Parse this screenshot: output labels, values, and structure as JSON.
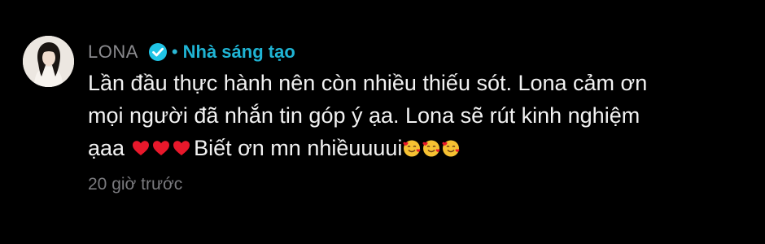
{
  "comment": {
    "username": "LONA",
    "verified_icon": "verified-check-icon",
    "badge_label": "Nhà sáng tạo",
    "text_lines": [
      "Lần đầu thực hành nên còn nhiều thiếu sót. Lona cảm ơn",
      "mọi người đã nhắn tin góp ý ạa. Lona sẽ rút kinh nghiệm",
      "ạaa",
      "Biết ơn mn nhiềuuuui"
    ],
    "emojis": {
      "hearts": [
        "red-heart-icon",
        "red-heart-icon",
        "red-heart-icon"
      ],
      "smiles": [
        "smiling-face-with-hearts-icon",
        "smiling-face-with-hearts-icon",
        "smiling-face-with-hearts-icon"
      ]
    },
    "timestamp": "20 giờ trước"
  },
  "colors": {
    "background": "#000000",
    "username": "#8a8a8e",
    "accent": "#1fb4d4",
    "text": "#f2f2f2",
    "timestamp": "#7a7a7e"
  }
}
